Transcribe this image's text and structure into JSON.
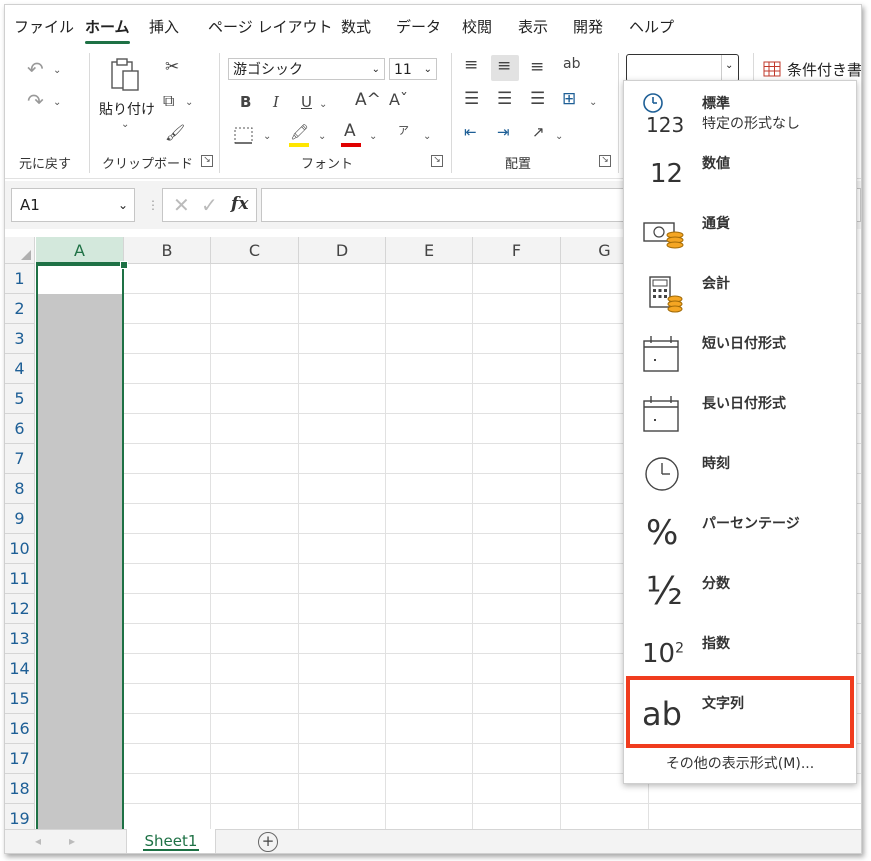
{
  "menubar": {
    "tabs": [
      {
        "label": "ファイル",
        "active": false
      },
      {
        "label": "ホーム",
        "active": true
      },
      {
        "label": "挿入",
        "active": false
      },
      {
        "label": "ページ レイアウト",
        "active": false
      },
      {
        "label": "数式",
        "active": false
      },
      {
        "label": "データ",
        "active": false
      },
      {
        "label": "校閲",
        "active": false
      },
      {
        "label": "表示",
        "active": false
      },
      {
        "label": "開発",
        "active": false
      },
      {
        "label": "ヘルプ",
        "active": false
      }
    ]
  },
  "ribbon": {
    "undo_group": {
      "label": "元に戻す"
    },
    "clipboard": {
      "label": "クリップボード",
      "paste_label": "貼り付け"
    },
    "font": {
      "label": "フォント",
      "font_name": "游ゴシック",
      "font_size": "11",
      "bold": "B",
      "italic": "I",
      "underline": "U",
      "grow": "A^",
      "shrink": "Aˇ",
      "font_color": "A",
      "ruby": "ア"
    },
    "alignment": {
      "label": "配置"
    },
    "number": {
      "format_value": ""
    },
    "styles": {
      "conditional_format": "条件付き書"
    }
  },
  "formula_bar": {
    "name_box": "A1",
    "fx": "fx",
    "formula": ""
  },
  "grid": {
    "columns": [
      "A",
      "B",
      "C",
      "D",
      "E",
      "F",
      "G"
    ],
    "rows": [
      "1",
      "2",
      "3",
      "4",
      "5",
      "6",
      "7",
      "8",
      "9",
      "10",
      "11",
      "12",
      "13",
      "14",
      "15",
      "16",
      "17",
      "18",
      "19"
    ],
    "selected_column": "A",
    "active_cell": "A1"
  },
  "sheets": {
    "tabs": [
      "Sheet1"
    ],
    "add_label": "+"
  },
  "format_menu": {
    "items": [
      {
        "label": "標準",
        "sublabel": "特定の形式なし",
        "icon": "clock-123-icon",
        "icon_text": "123"
      },
      {
        "label": "数値",
        "icon": "number-12-icon",
        "icon_text": "12"
      },
      {
        "label": "通貨",
        "icon": "currency-icon"
      },
      {
        "label": "会計",
        "icon": "accounting-calculator-icon"
      },
      {
        "label": "短い日付形式",
        "icon": "short-date-calendar-icon"
      },
      {
        "label": "長い日付形式",
        "icon": "long-date-calendar-icon"
      },
      {
        "label": "時刻",
        "icon": "clock-icon"
      },
      {
        "label": "パーセンテージ",
        "icon": "percent-icon",
        "icon_text": "%"
      },
      {
        "label": "分数",
        "icon": "fraction-icon",
        "icon_text": "½"
      },
      {
        "label": "指数",
        "icon": "scientific-icon",
        "icon_text": "10",
        "icon_sup": "2"
      },
      {
        "label": "文字列",
        "icon": "text-ab-icon",
        "icon_text": "ab",
        "highlighted": true
      }
    ],
    "more_formats": "その他の表示形式(M)..."
  },
  "colors": {
    "accent_green": "#1e7145",
    "highlight_red": "#f03c1e",
    "selection_gray": "#c6c6c6"
  }
}
